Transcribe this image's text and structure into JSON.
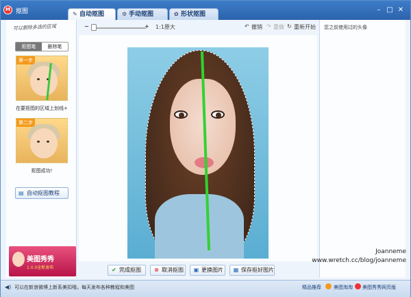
{
  "window": {
    "title": "抠图",
    "app_icon": "M",
    "min_icon": "–",
    "max_icon": "□",
    "close_icon": "✕"
  },
  "tabs": [
    {
      "label": "自动抠图",
      "icon": "magic-wand-icon",
      "active": true
    },
    {
      "label": "手动抠图",
      "icon": "gear-icon",
      "active": false
    },
    {
      "label": "形状抠图",
      "icon": "shape-icon",
      "active": false
    }
  ],
  "left_panel": {
    "hint": "可以删除多选的区域",
    "brush_modes": [
      "抠图笔",
      "删除笔"
    ],
    "step1_badge": "第一步",
    "step1_caption": "在要抠图的区域上划线+",
    "step2_badge": "第二步",
    "step2_caption": "抠图成功!",
    "tutorial_button": "自动抠图教程",
    "promo_title": "美图秀秀",
    "promo_sub": "1.0.0全新发布"
  },
  "toolbar": {
    "zoom_out": "−",
    "zoom_in": "+",
    "original_size": "1:1原大",
    "undo": "撤销",
    "redo": "重做",
    "restart": "重新开始"
  },
  "actions": {
    "complete": "完成抠图",
    "cancel": "取消抠图",
    "replace": "更换图片",
    "save": "保存抠好图片"
  },
  "right_panel": {
    "title": "您之前使用过的头像"
  },
  "watermark": {
    "name": "Joanneme",
    "url": "www.wretch.cc/blog/joanneme"
  },
  "statusbar": {
    "text": "可以在新浪微博上新系美扣哦，每天发布各种教程和美图",
    "links": [
      "精品推荐",
      "美图淘淘",
      "美图秀秀网页版"
    ]
  },
  "colors": {
    "titlebar": "#2c63ad",
    "accent": "#3d7cc9",
    "stroke": "#32d232"
  }
}
